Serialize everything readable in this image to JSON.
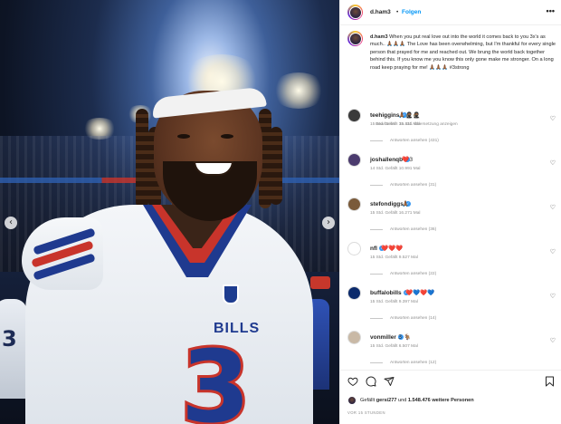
{
  "post": {
    "username": "d.ham3",
    "follow_label": "Folgen",
    "separator": "•",
    "more_label": "•••",
    "caption_text": "When you put real love out into the world it comes back to you 3x's as much.. 🙏🏾🙏🏾🙏🏾 The Love has been overwhelming, but I'm thankful for every single person that prayed for me and reached out. We brung the world back together behind this. If you know me you know this only gone make me stronger. On a long road keep praying for me! 🙏🏾🙏🏾🙏🏾 #3strong",
    "caption_meta": "Bearbeitet · 15 Std.    Übersetzung anzeigen",
    "image": {
      "jersey_text": "BILLS",
      "jersey_number": "3",
      "background_player_number": "3"
    }
  },
  "comments": [
    {
      "user": "teehiggins",
      "verified": true,
      "emoji": "🙏🏾🥷🏾🥷🏾",
      "meta": "15 Std.     Gefällt 35.411 Mal",
      "replies": "Antworten ansehen (431)"
    },
    {
      "user": "joshallenqb",
      "verified": true,
      "emoji": "❤️3",
      "meta": "14 Std.     Gefällt 10.991 Mal",
      "replies": "Antworten ansehen (31)"
    },
    {
      "user": "stefondiggs",
      "verified": true,
      "emoji": "🙏🏾",
      "meta": "15 Std.     Gefällt 16.271 Mal",
      "replies": "Antworten ansehen (36)"
    },
    {
      "user": "nfl",
      "verified": true,
      "emoji": "❤️❤️❤️",
      "meta": "15 Std.     Gefällt 9.527 Mal",
      "replies": "Antworten ansehen (22)"
    },
    {
      "user": "buffalobills",
      "verified": true,
      "emoji": "❤️💙❤️💙",
      "meta": "15 Std.     Gefällt 9.397 Mal",
      "replies": "Antworten ansehen (14)"
    },
    {
      "user": "vonmiller",
      "verified": true,
      "emoji": "3 🐐",
      "meta": "15 Std.     Gefällt 6.507 Mal",
      "replies": "Antworten ansehen (12)"
    }
  ],
  "actions": {
    "like_icon": "heart-icon",
    "comment_icon": "comment-icon",
    "share_icon": "share-icon",
    "save_icon": "bookmark-icon",
    "likes_prefix": "Gefällt ",
    "likes_user": "gersi277",
    "likes_middle": " und ",
    "likes_count": "1.548.476 weitere Personen",
    "date": "VOR 15 STUNDEN"
  },
  "nav": {
    "prev": "‹",
    "next": "›"
  },
  "colors": {
    "link": "#0095f6",
    "verified": "#3897f0",
    "bills_blue": "#1f3a8f",
    "bills_red": "#c8342b"
  }
}
